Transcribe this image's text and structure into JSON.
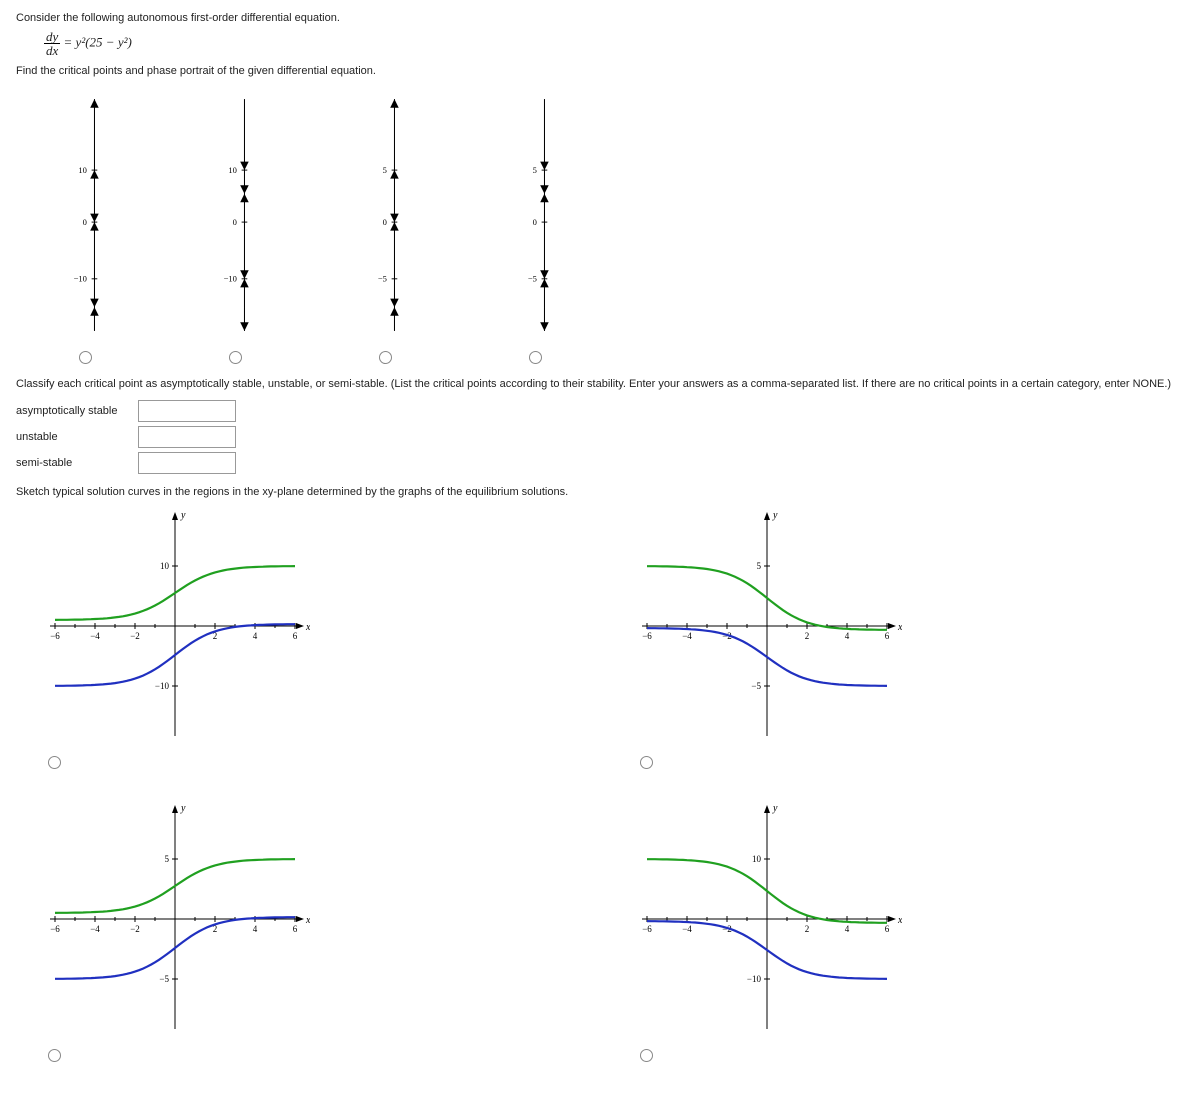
{
  "problem": {
    "intro": "Consider the following autonomous first-order differential equation.",
    "equation_num": "dy",
    "equation_den": "dx",
    "equation_rhs": " = y²(25 − y²)",
    "instruction1": "Find the critical points and phase portrait of the given differential equation.",
    "classify_instruction": "Classify each critical point as asymptotically stable, unstable, or semi-stable. (List the critical points according to their stability. Enter your answers as a comma-separated list. If there are no critical points in a certain category, enter NONE.)",
    "label_asymp": "asymptotically stable",
    "label_unstable": "unstable",
    "label_semi": "semi-stable",
    "instruction2": "Sketch typical solution curves in the regions in the xy-plane determined by the graphs of the equilibrium solutions."
  },
  "phase_portraits": [
    {
      "labels": {
        "top": "10",
        "bottom": "−10"
      },
      "arrows": [
        {
          "from": 90,
          "to": 15,
          "dir": "down"
        },
        {
          "from": 115,
          "to": 90,
          "dir": "up"
        },
        {
          "from": 115,
          "to": 145,
          "dir": "down"
        },
        {
          "from": 205,
          "to": 145,
          "dir": "up"
        },
        {
          "from": 205,
          "to": 235,
          "dir": "down"
        },
        {
          "from": 260,
          "to": 235,
          "dir": "up"
        }
      ]
    },
    {
      "labels": {
        "top": "10",
        "bottom": "−10"
      },
      "arrows": [
        {
          "from": 15,
          "to": 90,
          "dir": "down"
        },
        {
          "from": 90,
          "to": 115,
          "dir": "down"
        },
        {
          "from": 145,
          "to": 115,
          "dir": "up"
        },
        {
          "from": 145,
          "to": 205,
          "dir": "down"
        },
        {
          "from": 235,
          "to": 205,
          "dir": "up"
        },
        {
          "from": 235,
          "to": 260,
          "dir": "down"
        }
      ]
    },
    {
      "labels": {
        "top": "5",
        "bottom": "−5"
      },
      "arrows": [
        {
          "from": 90,
          "to": 15,
          "dir": "down"
        },
        {
          "from": 115,
          "to": 90,
          "dir": "up"
        },
        {
          "from": 115,
          "to": 145,
          "dir": "down"
        },
        {
          "from": 205,
          "to": 145,
          "dir": "up"
        },
        {
          "from": 205,
          "to": 235,
          "dir": "down"
        },
        {
          "from": 260,
          "to": 235,
          "dir": "up"
        }
      ]
    },
    {
      "labels": {
        "top": "5",
        "bottom": "−5"
      },
      "arrows": [
        {
          "from": 15,
          "to": 90,
          "dir": "down"
        },
        {
          "from": 90,
          "to": 115,
          "dir": "down"
        },
        {
          "from": 145,
          "to": 115,
          "dir": "up"
        },
        {
          "from": 145,
          "to": 205,
          "dir": "down"
        },
        {
          "from": 235,
          "to": 205,
          "dir": "up"
        },
        {
          "from": 235,
          "to": 260,
          "dir": "down"
        }
      ]
    }
  ],
  "solution_curves": [
    {
      "x_ticks": [
        "−6",
        "−4",
        "−2",
        "2",
        "4",
        "6"
      ],
      "y_top": "10",
      "y_bot": "−10",
      "flip": false
    },
    {
      "x_ticks": [
        "−6",
        "−4",
        "−2",
        "2",
        "4",
        "6"
      ],
      "y_top": "5",
      "y_bot": "−5",
      "flip": true
    },
    {
      "x_ticks": [
        "−6",
        "−4",
        "−2",
        "2",
        "4",
        "6"
      ],
      "y_top": "5",
      "y_bot": "−5",
      "flip": false
    },
    {
      "x_ticks": [
        "−6",
        "−4",
        "−2",
        "2",
        "4",
        "6"
      ],
      "y_top": "10",
      "y_bot": "−10",
      "flip": true
    }
  ],
  "chart_data": {
    "phase_portraits": [
      {
        "type": "phase-line",
        "critical_points": [
          10,
          0,
          -10
        ],
        "segments": [
          {
            "interval": "(10, ∞)",
            "direction": "down"
          },
          {
            "interval": "(0, 10)",
            "direction": "up"
          },
          {
            "interval": "(0, 10)",
            "direction": "down"
          },
          {
            "interval": "(-10, 0)",
            "direction": "up"
          },
          {
            "interval": "(-10, 0)",
            "direction": "down"
          },
          {
            "interval": "(-∞, -10)",
            "direction": "up"
          }
        ]
      },
      {
        "type": "phase-line",
        "critical_points": [
          10,
          0,
          -10
        ],
        "segments": [
          {
            "interval": "(10, ∞)",
            "direction": "down"
          },
          {
            "interval": "(0, 10)",
            "direction": "down"
          },
          {
            "interval": "(0, 10)",
            "direction": "up"
          },
          {
            "interval": "(-10, 0)",
            "direction": "down"
          },
          {
            "interval": "(-10, 0)",
            "direction": "up"
          },
          {
            "interval": "(-∞, -10)",
            "direction": "down"
          }
        ]
      },
      {
        "type": "phase-line",
        "critical_points": [
          5,
          0,
          -5
        ],
        "segments": [
          {
            "interval": "(5, ∞)",
            "direction": "down"
          },
          {
            "interval": "(0, 5)",
            "direction": "up"
          },
          {
            "interval": "(0, 5)",
            "direction": "down"
          },
          {
            "interval": "(-5, 0)",
            "direction": "up"
          },
          {
            "interval": "(-5, 0)",
            "direction": "down"
          },
          {
            "interval": "(-∞, -5)",
            "direction": "up"
          }
        ]
      },
      {
        "type": "phase-line",
        "critical_points": [
          5,
          0,
          -5
        ],
        "segments": [
          {
            "interval": "(5, ∞)",
            "direction": "down"
          },
          {
            "interval": "(0, 5)",
            "direction": "down"
          },
          {
            "interval": "(0, 5)",
            "direction": "up"
          },
          {
            "interval": "(-5, 0)",
            "direction": "down"
          },
          {
            "interval": "(-5, 0)",
            "direction": "up"
          },
          {
            "interval": "(-∞, -5)",
            "direction": "down"
          }
        ]
      }
    ],
    "solution_curves": [
      {
        "type": "line",
        "xlim": [
          -6,
          6
        ],
        "ylim": [
          -15,
          15
        ],
        "equilibrium_visible": [
          10,
          0,
          -10
        ],
        "curves": [
          {
            "description": "green curve rising from just above y=0 on left to y≈10 on right"
          },
          {
            "description": "blue curve rising from y≈-10 on left toward y=0 on right"
          }
        ]
      },
      {
        "type": "line",
        "xlim": [
          -6,
          6
        ],
        "ylim": [
          -8,
          8
        ],
        "equilibrium_visible": [
          5,
          0,
          -5
        ],
        "curves": [
          {
            "description": "green curve decreasing from y≈5 on left toward y=0 on right"
          },
          {
            "description": "blue curve decreasing from just below y=0 on left toward y≈-5 on right"
          }
        ]
      },
      {
        "type": "line",
        "xlim": [
          -6,
          6
        ],
        "ylim": [
          -8,
          8
        ],
        "equilibrium_visible": [
          5,
          0,
          -5
        ],
        "curves": [
          {
            "description": "green curve rising from just above y=0 on left to y≈5 on right"
          },
          {
            "description": "blue curve rising from y≈-5 on left toward y=0 on right"
          }
        ]
      },
      {
        "type": "line",
        "xlim": [
          -6,
          6
        ],
        "ylim": [
          -15,
          15
        ],
        "equilibrium_visible": [
          10,
          0,
          -10
        ],
        "curves": [
          {
            "description": "green curve decreasing from y≈10 on left toward y=0 on right"
          },
          {
            "description": "blue curve decreasing from just below y=0 on left toward y≈-10 on right"
          }
        ]
      }
    ]
  }
}
